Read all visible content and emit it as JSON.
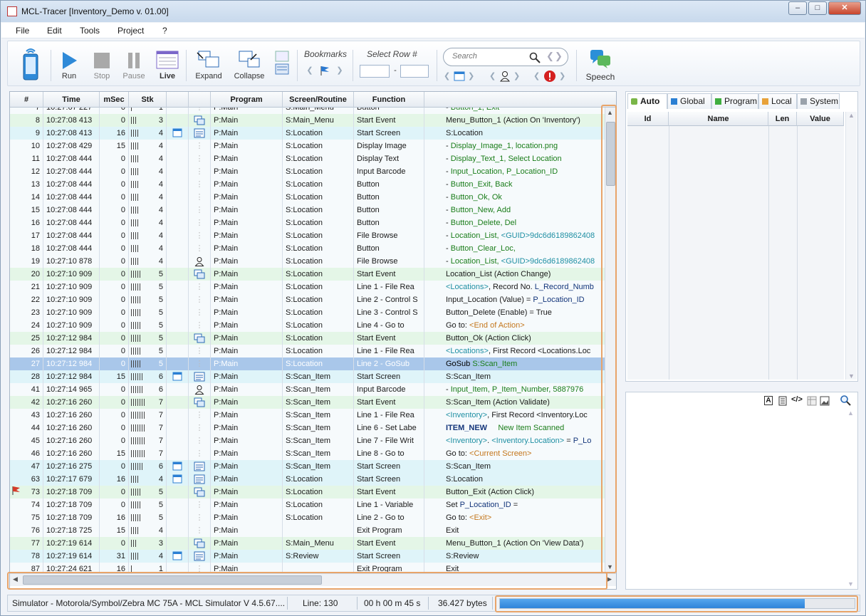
{
  "window": {
    "title": "MCL-Tracer [Inventory_Demo v. 01.00]",
    "min_label": "–",
    "max_label": "□",
    "close_label": "✕"
  },
  "menu": [
    {
      "label": "File"
    },
    {
      "label": "Edit"
    },
    {
      "label": "Tools"
    },
    {
      "label": "Project"
    },
    {
      "label": "?"
    }
  ],
  "toolbar": {
    "run": "Run",
    "stop": "Stop",
    "pause": "Pause",
    "live": "Live",
    "expand": "Expand",
    "collapse": "Collapse",
    "bookmarks": "Bookmarks",
    "select_row": "Select Row #",
    "row_sep": "-",
    "search_placeholder": "Search",
    "speech": "Speech"
  },
  "grid": {
    "columns": [
      "#",
      "Time",
      "mSec",
      "Stk",
      "",
      "",
      "Program",
      "Screen/Routine",
      "Function",
      ""
    ],
    "rows": [
      {
        "num": "7",
        "time": "10:27:07",
        "ms1": "227",
        "msec": "0",
        "ticks": 1,
        "stk": "1",
        "i1": "",
        "i2": "",
        "prog": "P:Main",
        "scr": "S:Main_Menu",
        "func": "Button",
        "d": [
          [
            "t",
            "- "
          ],
          [
            "g",
            "Button_1, Exit"
          ]
        ],
        "bg": "r-white",
        "flag": false
      },
      {
        "num": "8",
        "time": "10:27:08",
        "ms1": "413",
        "msec": "0",
        "ticks": 3,
        "stk": "3",
        "i1": "",
        "i2": "ev",
        "prog": "P:Main",
        "scr": "S:Main_Menu",
        "func": "Start Event",
        "d": [
          [
            "t",
            "Menu_Button_1 (Action On 'Inventory')"
          ]
        ],
        "bg": "r-green",
        "flag": false
      },
      {
        "num": "9",
        "time": "10:27:08",
        "ms1": "413",
        "msec": "16",
        "ticks": 4,
        "stk": "4",
        "i1": "win",
        "i2": "scr",
        "prog": "P:Main",
        "scr": "S:Location",
        "func": "Start Screen",
        "d": [
          [
            "t",
            "S:Location"
          ]
        ],
        "bg": "r-cyan",
        "flag": false
      },
      {
        "num": "10",
        "time": "10:27:08",
        "ms1": "429",
        "msec": "15",
        "ticks": 4,
        "stk": "4",
        "i1": "",
        "i2": "",
        "prog": "P:Main",
        "scr": "S:Location",
        "func": "Display Image",
        "d": [
          [
            "t",
            "- "
          ],
          [
            "g",
            "Display_Image_1, location.png"
          ]
        ],
        "bg": "r-white",
        "flag": false
      },
      {
        "num": "11",
        "time": "10:27:08",
        "ms1": "444",
        "msec": "0",
        "ticks": 4,
        "stk": "4",
        "i1": "",
        "i2": "",
        "prog": "P:Main",
        "scr": "S:Location",
        "func": "Display Text",
        "d": [
          [
            "t",
            "- "
          ],
          [
            "g",
            "Display_Text_1, Select Location"
          ]
        ],
        "bg": "r-white",
        "flag": false
      },
      {
        "num": "12",
        "time": "10:27:08",
        "ms1": "444",
        "msec": "0",
        "ticks": 4,
        "stk": "4",
        "i1": "",
        "i2": "",
        "prog": "P:Main",
        "scr": "S:Location",
        "func": "Input Barcode",
        "d": [
          [
            "t",
            "- "
          ],
          [
            "g",
            "Input_Location, P_Location_ID"
          ]
        ],
        "bg": "r-white",
        "flag": false
      },
      {
        "num": "13",
        "time": "10:27:08",
        "ms1": "444",
        "msec": "0",
        "ticks": 4,
        "stk": "4",
        "i1": "",
        "i2": "",
        "prog": "P:Main",
        "scr": "S:Location",
        "func": "Button",
        "d": [
          [
            "t",
            "- "
          ],
          [
            "g",
            "Button_Exit, Back"
          ]
        ],
        "bg": "r-white",
        "flag": false
      },
      {
        "num": "14",
        "time": "10:27:08",
        "ms1": "444",
        "msec": "0",
        "ticks": 4,
        "stk": "4",
        "i1": "",
        "i2": "",
        "prog": "P:Main",
        "scr": "S:Location",
        "func": "Button",
        "d": [
          [
            "t",
            "- "
          ],
          [
            "g",
            "Button_Ok, Ok"
          ]
        ],
        "bg": "r-white",
        "flag": false
      },
      {
        "num": "15",
        "time": "10:27:08",
        "ms1": "444",
        "msec": "0",
        "ticks": 4,
        "stk": "4",
        "i1": "",
        "i2": "",
        "prog": "P:Main",
        "scr": "S:Location",
        "func": "Button",
        "d": [
          [
            "t",
            "- "
          ],
          [
            "g",
            "Button_New, Add"
          ]
        ],
        "bg": "r-white",
        "flag": false
      },
      {
        "num": "16",
        "time": "10:27:08",
        "ms1": "444",
        "msec": "0",
        "ticks": 4,
        "stk": "4",
        "i1": "",
        "i2": "",
        "prog": "P:Main",
        "scr": "S:Location",
        "func": "Button",
        "d": [
          [
            "t",
            "- "
          ],
          [
            "g",
            "Button_Delete, Del"
          ]
        ],
        "bg": "r-white",
        "flag": false
      },
      {
        "num": "17",
        "time": "10:27:08",
        "ms1": "444",
        "msec": "0",
        "ticks": 4,
        "stk": "4",
        "i1": "",
        "i2": "",
        "prog": "P:Main",
        "scr": "S:Location",
        "func": "File Browse",
        "d": [
          [
            "t",
            "- "
          ],
          [
            "g",
            "Location_List, "
          ],
          [
            "c",
            "<GUID>9dc6d6189862408"
          ]
        ],
        "bg": "r-white",
        "flag": false
      },
      {
        "num": "18",
        "time": "10:27:08",
        "ms1": "444",
        "msec": "0",
        "ticks": 4,
        "stk": "4",
        "i1": "",
        "i2": "",
        "prog": "P:Main",
        "scr": "S:Location",
        "func": "Button",
        "d": [
          [
            "t",
            "- "
          ],
          [
            "g",
            "Button_Clear_Loc,"
          ]
        ],
        "bg": "r-white",
        "flag": false
      },
      {
        "num": "19",
        "time": "10:27:10",
        "ms1": "878",
        "msec": "0",
        "ticks": 4,
        "stk": "4",
        "i1": "",
        "i2": "user",
        "prog": "P:Main",
        "scr": "S:Location",
        "func": "File Browse",
        "d": [
          [
            "t",
            "- "
          ],
          [
            "g",
            "Location_List, "
          ],
          [
            "c",
            "<GUID>9dc6d6189862408"
          ]
        ],
        "bg": "r-white",
        "flag": false
      },
      {
        "num": "20",
        "time": "10:27:10",
        "ms1": "909",
        "msec": "0",
        "ticks": 5,
        "stk": "5",
        "i1": "",
        "i2": "ev",
        "prog": "P:Main",
        "scr": "S:Location",
        "func": "Start Event",
        "d": [
          [
            "t",
            "Location_List (Action Change)"
          ]
        ],
        "bg": "r-green",
        "flag": false
      },
      {
        "num": "21",
        "time": "10:27:10",
        "ms1": "909",
        "msec": "0",
        "ticks": 5,
        "stk": "5",
        "i1": "",
        "i2": "",
        "prog": "P:Main",
        "scr": "S:Location",
        "func": "Line 1 - File Rea",
        "d": [
          [
            "c",
            "<Locations>"
          ],
          [
            "t",
            ", Record No. "
          ],
          [
            "n2",
            "L_Record_Numb"
          ]
        ],
        "bg": "r-white",
        "flag": false
      },
      {
        "num": "22",
        "time": "10:27:10",
        "ms1": "909",
        "msec": "0",
        "ticks": 5,
        "stk": "5",
        "i1": "",
        "i2": "",
        "prog": "P:Main",
        "scr": "S:Location",
        "func": "Line 2 - Control S",
        "d": [
          [
            "t",
            "Input_Location (Value) = "
          ],
          [
            "n2",
            "P_Location_ID"
          ]
        ],
        "bg": "r-white",
        "flag": false
      },
      {
        "num": "23",
        "time": "10:27:10",
        "ms1": "909",
        "msec": "0",
        "ticks": 5,
        "stk": "5",
        "i1": "",
        "i2": "",
        "prog": "P:Main",
        "scr": "S:Location",
        "func": "Line 3 - Control S",
        "d": [
          [
            "t",
            "Button_Delete (Enable) = True"
          ]
        ],
        "bg": "r-white",
        "flag": false
      },
      {
        "num": "24",
        "time": "10:27:10",
        "ms1": "909",
        "msec": "0",
        "ticks": 5,
        "stk": "5",
        "i1": "",
        "i2": "",
        "prog": "P:Main",
        "scr": "S:Location",
        "func": "Line 4 - Go to",
        "d": [
          [
            "t",
            "Go to: "
          ],
          [
            "o",
            "<End of Action>"
          ]
        ],
        "bg": "r-white",
        "flag": false
      },
      {
        "num": "25",
        "time": "10:27:12",
        "ms1": "984",
        "msec": "0",
        "ticks": 5,
        "stk": "5",
        "i1": "",
        "i2": "ev",
        "prog": "P:Main",
        "scr": "S:Location",
        "func": "Start Event",
        "d": [
          [
            "t",
            "Button_Ok (Action Click)"
          ]
        ],
        "bg": "r-green",
        "flag": false
      },
      {
        "num": "26",
        "time": "10:27:12",
        "ms1": "984",
        "msec": "0",
        "ticks": 5,
        "stk": "5",
        "i1": "",
        "i2": "",
        "prog": "P:Main",
        "scr": "S:Location",
        "func": "Line 1 - File Rea",
        "d": [
          [
            "c",
            "<Locations>"
          ],
          [
            "t",
            ", First Record <Locations.Loc"
          ]
        ],
        "bg": "r-white",
        "flag": false
      },
      {
        "num": "27",
        "time": "10:27:12",
        "ms1": "984",
        "msec": "0",
        "ticks": 5,
        "stk": "5",
        "i1": "",
        "i2": "",
        "prog": "P:Main",
        "scr": "S:Location",
        "func": "Line 2 - GoSub",
        "d": [
          [
            "t",
            "GoSub "
          ],
          [
            "g",
            "S:Scan_Item"
          ]
        ],
        "bg": "r-sel",
        "flag": false
      },
      {
        "num": "28",
        "time": "10:27:12",
        "ms1": "984",
        "msec": "15",
        "ticks": 6,
        "stk": "6",
        "i1": "win",
        "i2": "scr",
        "prog": "P:Main",
        "scr": "S:Scan_Item",
        "func": "Start Screen",
        "d": [
          [
            "t",
            "S:Scan_Item"
          ]
        ],
        "bg": "r-cyan",
        "flag": false
      },
      {
        "num": "41",
        "time": "10:27:14",
        "ms1": "965",
        "msec": "0",
        "ticks": 6,
        "stk": "6",
        "i1": "",
        "i2": "user",
        "prog": "P:Main",
        "scr": "S:Scan_Item",
        "func": "Input Barcode",
        "d": [
          [
            "t",
            "- "
          ],
          [
            "g",
            "Input_Item, P_Item_Number, 5887976"
          ]
        ],
        "bg": "r-white",
        "flag": false
      },
      {
        "num": "42",
        "time": "10:27:16",
        "ms1": "260",
        "msec": "0",
        "ticks": 7,
        "stk": "7",
        "i1": "",
        "i2": "ev",
        "prog": "P:Main",
        "scr": "S:Scan_Item",
        "func": "Start Event",
        "d": [
          [
            "t",
            "S:Scan_Item (Action Validate)"
          ]
        ],
        "bg": "r-green",
        "flag": false
      },
      {
        "num": "43",
        "time": "10:27:16",
        "ms1": "260",
        "msec": "0",
        "ticks": 7,
        "stk": "7",
        "i1": "",
        "i2": "",
        "prog": "P:Main",
        "scr": "S:Scan_Item",
        "func": "Line 1 - File Rea",
        "d": [
          [
            "c",
            "<Inventory>"
          ],
          [
            "t",
            ", First Record <Inventory.Loc"
          ]
        ],
        "bg": "r-white",
        "flag": false
      },
      {
        "num": "44",
        "time": "10:27:16",
        "ms1": "260",
        "msec": "0",
        "ticks": 7,
        "stk": "7",
        "i1": "",
        "i2": "",
        "prog": "P:Main",
        "scr": "S:Scan_Item",
        "func": "Line 6 - Set Labe",
        "d": [
          [
            "n",
            "ITEM_NEW"
          ],
          [
            "t",
            "     "
          ],
          [
            "g",
            "New Item Scanned"
          ]
        ],
        "bg": "r-white",
        "flag": false
      },
      {
        "num": "45",
        "time": "10:27:16",
        "ms1": "260",
        "msec": "0",
        "ticks": 7,
        "stk": "7",
        "i1": "",
        "i2": "",
        "prog": "P:Main",
        "scr": "S:Scan_Item",
        "func": "Line 7 - File Writ",
        "d": [
          [
            "c",
            "<Inventory>"
          ],
          [
            "t",
            ". "
          ],
          [
            "c",
            "<Inventory.Location>"
          ],
          [
            "t",
            " = "
          ],
          [
            "n2",
            "P_Lo"
          ]
        ],
        "bg": "r-white",
        "flag": false
      },
      {
        "num": "46",
        "time": "10:27:16",
        "ms1": "260",
        "msec": "15",
        "ticks": 7,
        "stk": "7",
        "i1": "",
        "i2": "",
        "prog": "P:Main",
        "scr": "S:Scan_Item",
        "func": "Line 8 - Go to",
        "d": [
          [
            "t",
            "Go to: "
          ],
          [
            "o",
            "<Current Screen>"
          ]
        ],
        "bg": "r-white",
        "flag": false
      },
      {
        "num": "47",
        "time": "10:27:16",
        "ms1": "275",
        "msec": "0",
        "ticks": 6,
        "stk": "6",
        "i1": "win",
        "i2": "scr",
        "prog": "P:Main",
        "scr": "S:Scan_Item",
        "func": "Start Screen",
        "d": [
          [
            "t",
            "S:Scan_Item"
          ]
        ],
        "bg": "r-cyan",
        "flag": false
      },
      {
        "num": "63",
        "time": "10:27:17",
        "ms1": "679",
        "msec": "16",
        "ticks": 4,
        "stk": "4",
        "i1": "win",
        "i2": "scr",
        "prog": "P:Main",
        "scr": "S:Location",
        "func": "Start Screen",
        "d": [
          [
            "t",
            "S:Location"
          ]
        ],
        "bg": "r-cyan",
        "flag": false
      },
      {
        "num": "73",
        "time": "10:27:18",
        "ms1": "709",
        "msec": "0",
        "ticks": 5,
        "stk": "5",
        "i1": "",
        "i2": "ev",
        "prog": "P:Main",
        "scr": "S:Location",
        "func": "Start Event",
        "d": [
          [
            "t",
            "Button_Exit (Action Click)"
          ]
        ],
        "bg": "r-green",
        "flag": true
      },
      {
        "num": "74",
        "time": "10:27:18",
        "ms1": "709",
        "msec": "0",
        "ticks": 5,
        "stk": "5",
        "i1": "",
        "i2": "",
        "prog": "P:Main",
        "scr": "S:Location",
        "func": "Line 1 - Variable",
        "d": [
          [
            "t",
            "Set "
          ],
          [
            "n2",
            "P_Location_ID"
          ],
          [
            "t",
            " ="
          ]
        ],
        "bg": "r-white",
        "flag": false
      },
      {
        "num": "75",
        "time": "10:27:18",
        "ms1": "709",
        "msec": "16",
        "ticks": 5,
        "stk": "5",
        "i1": "",
        "i2": "",
        "prog": "P:Main",
        "scr": "S:Location",
        "func": "Line 2 - Go to",
        "d": [
          [
            "t",
            "Go to: "
          ],
          [
            "o",
            "<Exit>"
          ]
        ],
        "bg": "r-white",
        "flag": false
      },
      {
        "num": "76",
        "time": "10:27:18",
        "ms1": "725",
        "msec": "15",
        "ticks": 4,
        "stk": "4",
        "i1": "",
        "i2": "",
        "prog": "P:Main",
        "scr": "",
        "func": "Exit Program",
        "d": [
          [
            "t",
            "Exit"
          ]
        ],
        "bg": "r-white",
        "flag": false
      },
      {
        "num": "77",
        "time": "10:27:19",
        "ms1": "614",
        "msec": "0",
        "ticks": 3,
        "stk": "3",
        "i1": "",
        "i2": "ev",
        "prog": "P:Main",
        "scr": "S:Main_Menu",
        "func": "Start Event",
        "d": [
          [
            "t",
            "Menu_Button_1 (Action On 'View Data')"
          ]
        ],
        "bg": "r-green",
        "flag": false
      },
      {
        "num": "78",
        "time": "10:27:19",
        "ms1": "614",
        "msec": "31",
        "ticks": 4,
        "stk": "4",
        "i1": "win",
        "i2": "scr",
        "prog": "P:Main",
        "scr": "S:Review",
        "func": "Start Screen",
        "d": [
          [
            "t",
            "S:Review"
          ]
        ],
        "bg": "r-cyan",
        "flag": false
      },
      {
        "num": "87",
        "time": "10:27:24",
        "ms1": "621",
        "msec": "16",
        "ticks": 1,
        "stk": "1",
        "i1": "",
        "i2": "",
        "prog": "P:Main",
        "scr": "",
        "func": "Exit Program",
        "d": [
          [
            "t",
            "Exit"
          ]
        ],
        "bg": "r-white",
        "flag": false
      }
    ]
  },
  "var_panel": {
    "tabs": [
      {
        "label": "Auto",
        "color": "#7ab648"
      },
      {
        "label": "Global",
        "color": "#2b7fd3"
      },
      {
        "label": "Program",
        "color": "#3fae3f"
      },
      {
        "label": "Local",
        "color": "#e8a23a"
      },
      {
        "label": "System",
        "color": "#9aa2ab"
      }
    ],
    "columns": [
      "Id",
      "Name",
      "Len",
      "Value"
    ]
  },
  "status": {
    "device": "Simulator - Motorola/Symbol/Zebra MC 75A - MCL Simulator V 4.5.67....",
    "line": "Line: 130",
    "elapsed": "00 h 00 m 45 s",
    "bytes": "36.427 bytes",
    "progress": 0.86
  },
  "colors": {
    "highlight": "#e8a46a",
    "progress": "#3a8ee6"
  }
}
